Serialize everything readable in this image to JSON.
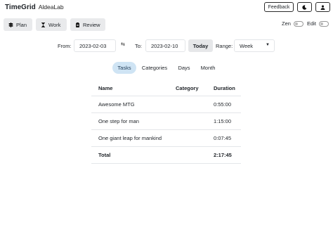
{
  "header": {
    "app_name": "TimeGrid",
    "org_name": "AldeaLab",
    "feedback_label": "Feedback",
    "theme_icon": "moon-icon",
    "profile_icon": "user-icon"
  },
  "toolbar": {
    "buttons": [
      {
        "label": "Plan",
        "icon": "signpost-icon"
      },
      {
        "label": "Work",
        "icon": "hourglass-icon"
      },
      {
        "label": "Review",
        "icon": "clipboard-icon"
      }
    ],
    "toggles": [
      {
        "label": "Zen",
        "on": false
      },
      {
        "label": "Edit",
        "on": false
      }
    ]
  },
  "date_filter": {
    "from_label": "From:",
    "from_value": "2023-02-03",
    "swap_icon": "swap-icon",
    "to_label": "To:",
    "to_value": "2023-02-10",
    "today_label": "Today",
    "range_label": "Range:",
    "range_value": "Week"
  },
  "tabs": [
    {
      "label": "Tasks",
      "active": true
    },
    {
      "label": "Categories",
      "active": false
    },
    {
      "label": "Days",
      "active": false
    },
    {
      "label": "Month",
      "active": false
    }
  ],
  "table": {
    "columns": [
      "Name",
      "Category",
      "Duration"
    ],
    "rows": [
      {
        "name": "Awesome MTG",
        "category": "",
        "duration": "0:55:00"
      },
      {
        "name": "One step for man",
        "category": "",
        "duration": "1:15:00"
      },
      {
        "name": "One giant leap for mankind",
        "category": "",
        "duration": "0:07:45"
      }
    ],
    "total": {
      "name": "Total",
      "category": "",
      "duration": "2:17:45"
    }
  }
}
